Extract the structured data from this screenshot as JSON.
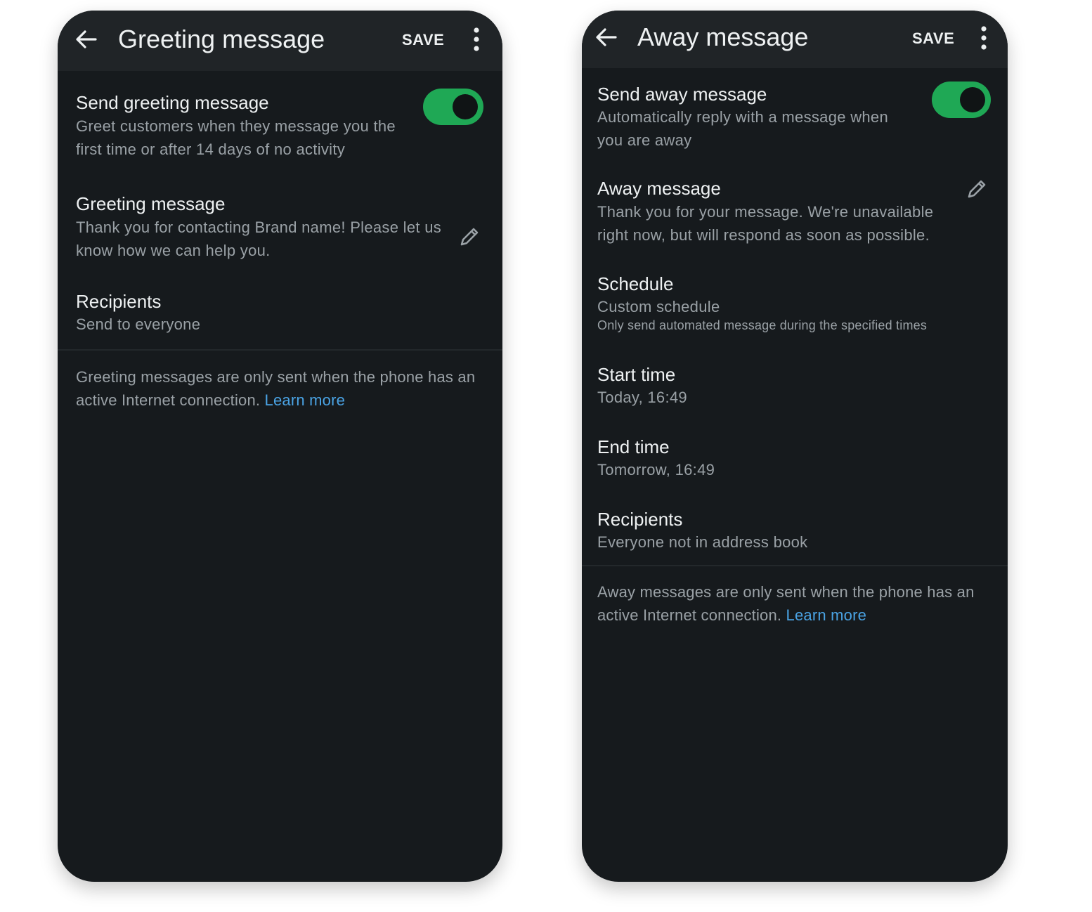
{
  "colors": {
    "toggle_on": "#1fa855",
    "link": "#4aa3e4",
    "screen_bg": "#161a1d",
    "appbar_bg": "#202427"
  },
  "greeting_screen": {
    "appbar": {
      "title": "Greeting message",
      "save_label": "SAVE",
      "back_icon": "arrow-left-icon",
      "more_icon": "more-vertical-icon"
    },
    "send_toggle": {
      "title": "Send greeting message",
      "subtitle": "Greet customers when they message you the first time or after 14 days of no activity",
      "enabled": true
    },
    "message": {
      "title": "Greeting message",
      "text": "Thank you for contacting Brand name! Please let us know how we can help you.",
      "edit_icon": "pencil-icon"
    },
    "recipients": {
      "title": "Recipients",
      "value": "Send to everyone"
    },
    "footer": {
      "note": "Greeting messages are only sent when the phone has an active Internet connection.",
      "link": "Learn more"
    }
  },
  "away_screen": {
    "appbar": {
      "title": "Away message",
      "save_label": "SAVE",
      "back_icon": "arrow-left-icon",
      "more_icon": "more-vertical-icon"
    },
    "send_toggle": {
      "title": "Send away message",
      "subtitle": "Automatically reply with a message when you are away",
      "enabled": true
    },
    "message": {
      "title": "Away message",
      "text": "Thank you for your message. We're unavailable right now, but will respond as soon as possible.",
      "edit_icon": "pencil-icon"
    },
    "schedule": {
      "title": "Schedule",
      "value": "Custom schedule",
      "hint": "Only send automated message during the specified times"
    },
    "start_time": {
      "title": "Start time",
      "value": "Today, 16:49"
    },
    "end_time": {
      "title": "End time",
      "value": "Tomorrow, 16:49"
    },
    "recipients": {
      "title": "Recipients",
      "value": "Everyone not in address book"
    },
    "footer": {
      "note": "Away messages are only sent when the phone has an active Internet connection.",
      "link": "Learn more"
    }
  }
}
